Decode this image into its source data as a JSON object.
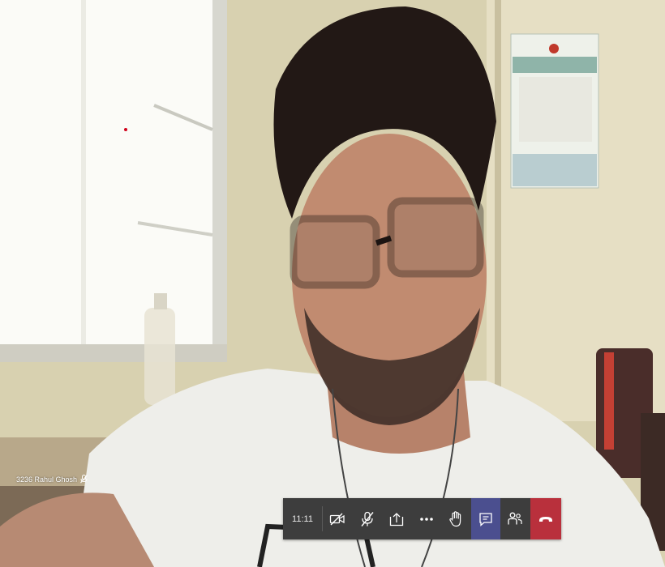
{
  "participant": {
    "name_label": "3236 Rahul Ghosh"
  },
  "call_toolbar": {
    "timer": "11:11",
    "buttons": [
      {
        "name": "camera-off-button",
        "icon": "video-off-icon"
      },
      {
        "name": "mic-off-button",
        "icon": "mic-off-icon"
      },
      {
        "name": "share-screen-button",
        "icon": "share-tray-icon"
      },
      {
        "name": "more-actions-button",
        "icon": "ellipsis-icon"
      },
      {
        "name": "raise-hand-button",
        "icon": "hand-icon"
      },
      {
        "name": "chat-button",
        "icon": "chat-icon",
        "active": true
      },
      {
        "name": "participants-button",
        "icon": "people-icon"
      },
      {
        "name": "hang-up-button",
        "icon": "phone-hangup-icon"
      }
    ],
    "colors": {
      "bar": "#3d3d3d",
      "active": "#4b4f8f",
      "hangup": "#b9303c"
    }
  }
}
